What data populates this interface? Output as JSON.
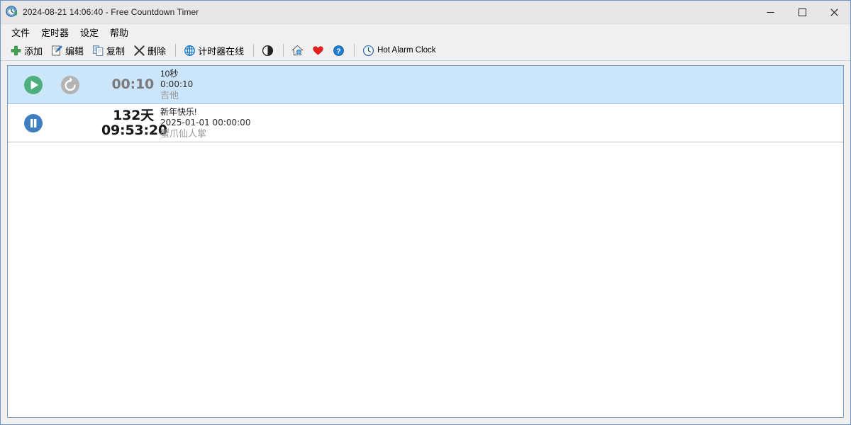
{
  "window": {
    "title": "2024-08-21 14:06:40 - Free Countdown Timer",
    "icon": "countdown-clock-icon",
    "controls": {
      "minimize": "─",
      "maximize": "□",
      "close": "✕"
    }
  },
  "menubar": {
    "items": [
      {
        "label": "文件",
        "name": "menu-file"
      },
      {
        "label": "定时器",
        "name": "menu-timer"
      },
      {
        "label": "设定",
        "name": "menu-settings"
      },
      {
        "label": "帮助",
        "name": "menu-help"
      }
    ]
  },
  "toolbar": {
    "add_label": "添加",
    "edit_label": "编辑",
    "copy_label": "复制",
    "delete_label": "删除",
    "online_label": "计时器在线",
    "hot_alarm_label": "Hot Alarm Clock",
    "icons": {
      "add": "plus-icon",
      "edit": "pencil-edit-icon",
      "copy": "copy-icon",
      "delete": "x-delete-icon",
      "online": "globe-icon",
      "theme": "contrast-circle-icon",
      "home": "home-globe-icon",
      "donate": "heart-icon",
      "help": "question-help-icon",
      "hot_alarm": "clock-icon"
    }
  },
  "colors": {
    "selection": "#cbe5fb",
    "play_green": "#4caf7d",
    "pause_blue": "#3f7fc1",
    "reset_gray": "#b3b3b3",
    "accent_border": "#7a9bc4",
    "heart_red": "#e02020",
    "globe_blue": "#1878c8"
  },
  "timers": [
    {
      "name": "timer-row-1",
      "selected": true,
      "state": "running",
      "buttons": [
        "play-button",
        "reset-button"
      ],
      "time_line1": "00:10",
      "time_line2": "",
      "time_style": "gray",
      "title": "10秒",
      "target": "0:00:10",
      "sound": "吉他"
    },
    {
      "name": "timer-row-2",
      "selected": false,
      "state": "paused",
      "buttons": [
        "pause-button"
      ],
      "time_line1": "132天",
      "time_line2": "09:53:20",
      "time_style": "dark",
      "title": "新年快乐!",
      "target": "2025-01-01 00:00:00",
      "sound": "蟹爪仙人掌"
    }
  ]
}
